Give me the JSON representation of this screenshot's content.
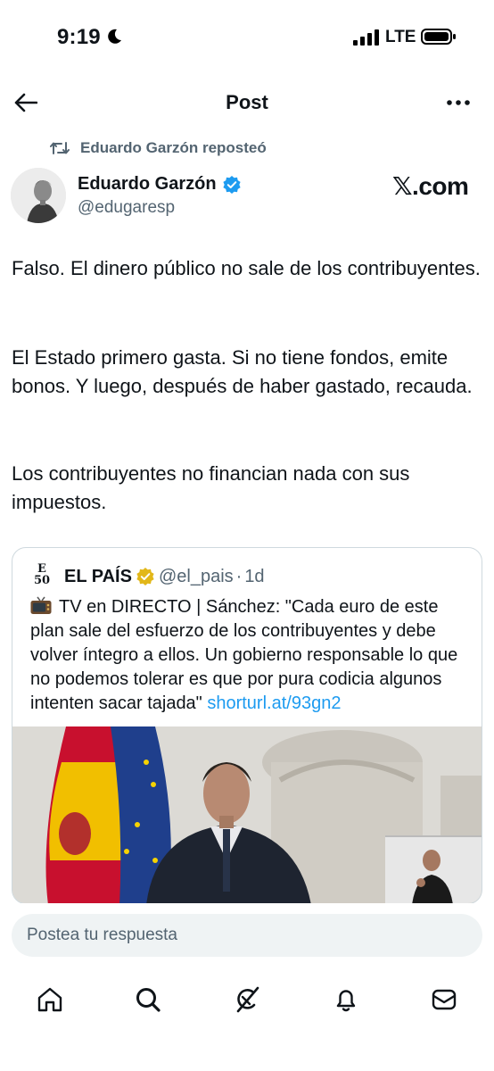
{
  "status_bar": {
    "time": "9:19",
    "network": "LTE"
  },
  "header": {
    "title": "Post"
  },
  "repost": {
    "text": "Eduardo Garzón reposteó"
  },
  "author": {
    "name": "Eduardo Garzón",
    "handle": "@edugaresp",
    "watermark": "𝕏.com"
  },
  "post": {
    "paragraphs": [
      "Falso. El dinero público no sale de los contribuyentes.",
      "El Estado primero gasta. Si no tiene fondos, emite bonos. Y luego, después de haber gastado, recauda.",
      "Los contribuyentes no financian nada con sus impuestos."
    ]
  },
  "quote": {
    "logo_text": "E 50",
    "name": "EL PAÍS",
    "handle": "@el_pais",
    "separator": "·",
    "time": "1d",
    "text": "TV en DIRECTO | Sánchez: \"Cada euro de este plan sale del esfuerzo de los contribuyentes y debe volver íntegro a ellos. Un gobierno responsable lo que no podemos tolerar es que por pura codicia algunos intenten sacar tajada\" ",
    "link": "shorturl.at/93gn2"
  },
  "reply": {
    "placeholder": "Postea tu respuesta"
  },
  "nav": {
    "items": [
      "home-icon",
      "search-icon",
      "grok-icon",
      "notifications-icon",
      "messages-icon"
    ]
  },
  "colors": {
    "accent": "#1d9bf0",
    "secondary_text": "#536471",
    "gold_badge": "#e2b719"
  }
}
